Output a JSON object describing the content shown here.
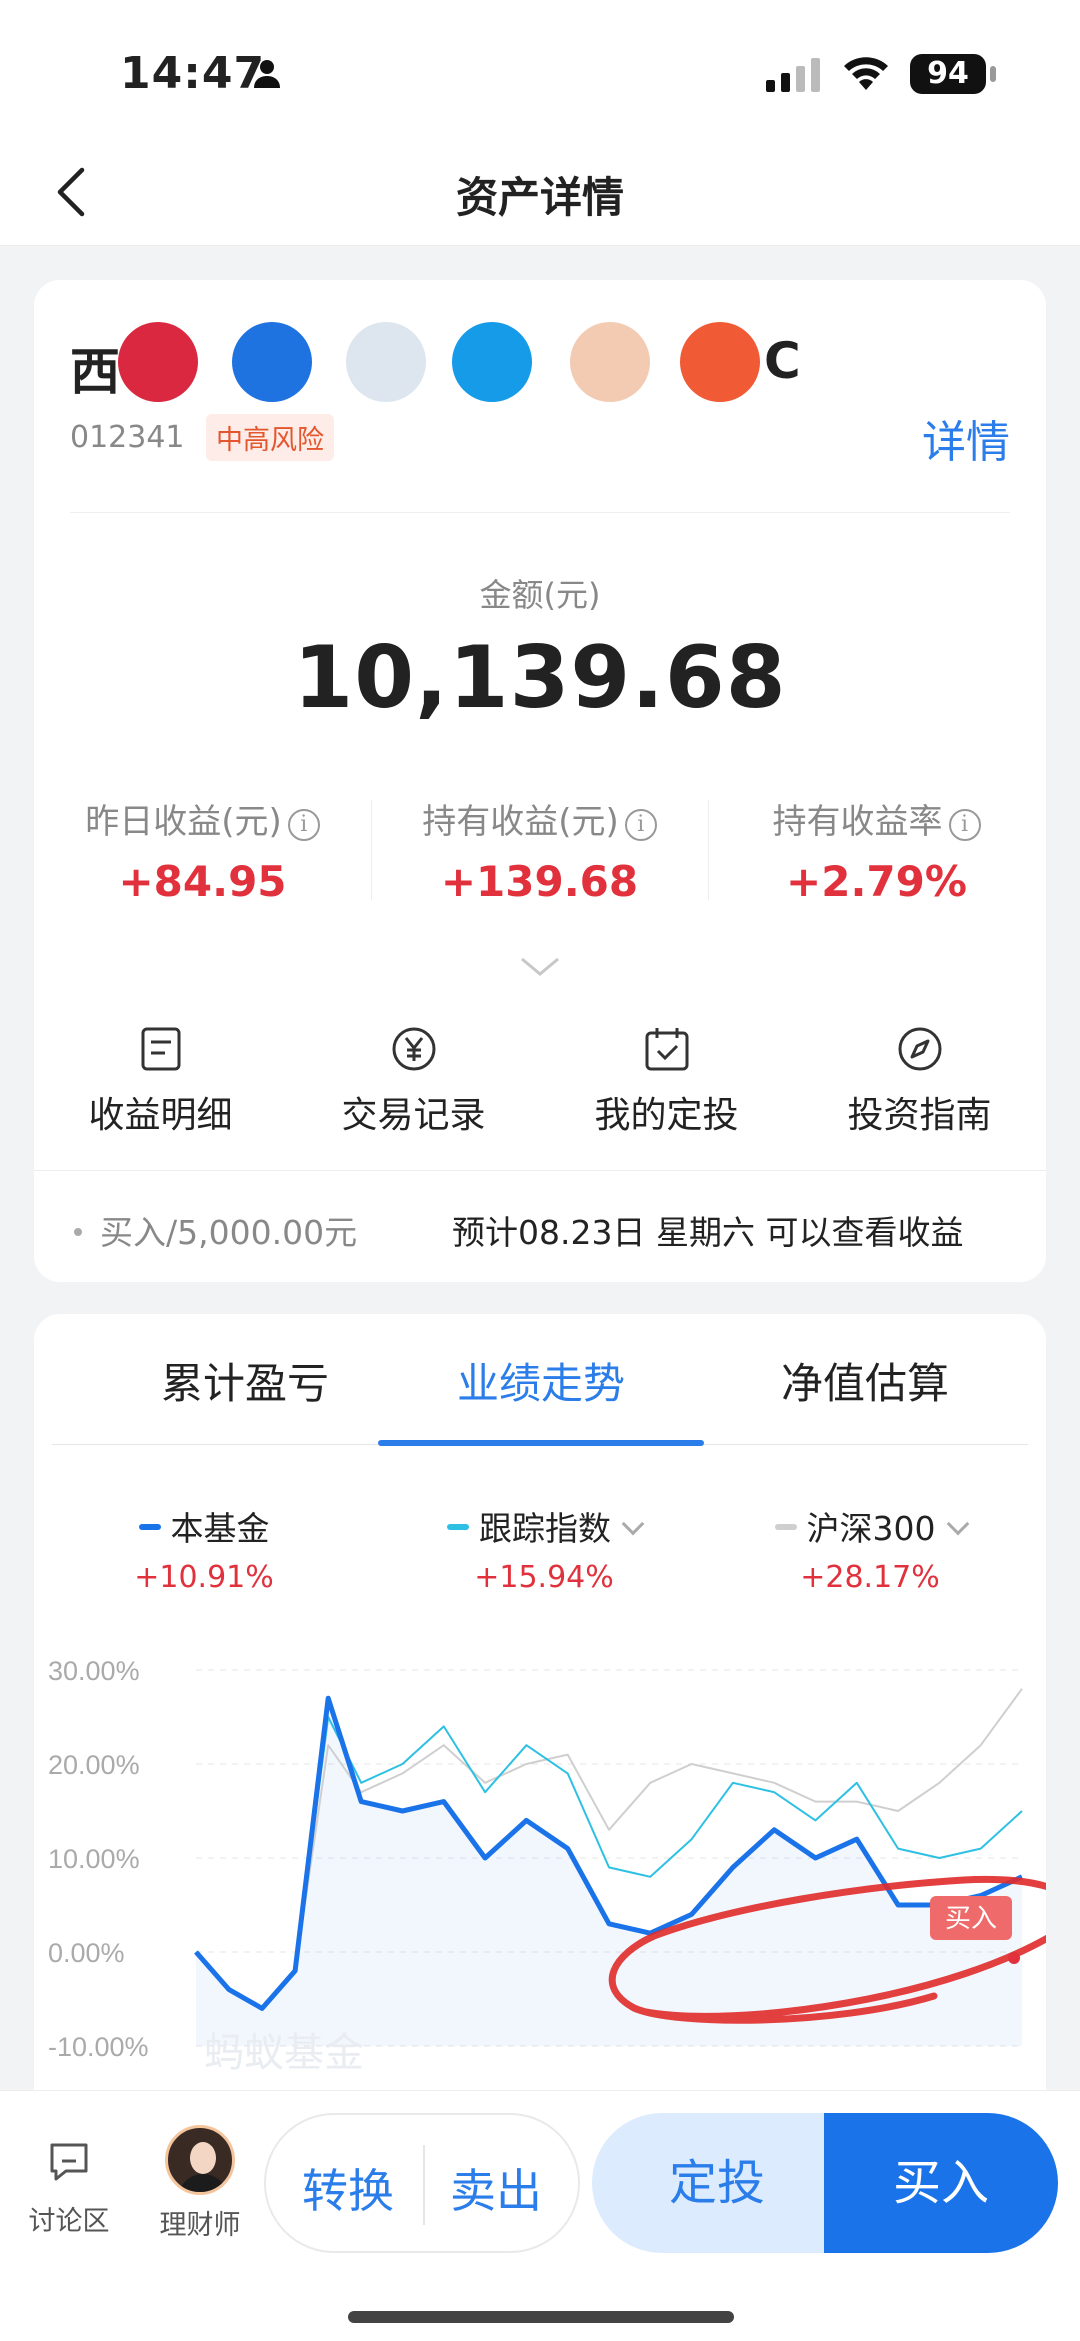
{
  "status_bar": {
    "time": "14:47",
    "battery": "94"
  },
  "nav": {
    "title": "资产详情"
  },
  "fund": {
    "name_visible_start": "西",
    "name_visible_end": "C",
    "code": "012341",
    "risk": "中高风险",
    "detail_link": "详情"
  },
  "amount": {
    "label": "金额(元)",
    "value": "10,139.68"
  },
  "stats": [
    {
      "label": "昨日收益(元)",
      "value": "+84.95"
    },
    {
      "label": "持有收益(元)",
      "value": "+139.68"
    },
    {
      "label": "持有收益率",
      "value": "+2.79%"
    }
  ],
  "actions": [
    {
      "label": "收益明细",
      "icon": "document-icon"
    },
    {
      "label": "交易记录",
      "icon": "yen-circle-icon"
    },
    {
      "label": "我的定投",
      "icon": "calendar-check-icon"
    },
    {
      "label": "投资指南",
      "icon": "compass-icon"
    }
  ],
  "buy_note": {
    "text": "买入/5,000.00元",
    "expect": "预计08.23日 星期六 可以查看收益"
  },
  "tabs": [
    "累计盈亏",
    "业绩走势",
    "净值估算"
  ],
  "active_tab": 1,
  "legend": [
    {
      "name": "本基金",
      "value": "+10.91%",
      "color": "#1a73e8"
    },
    {
      "name": "跟踪指数",
      "value": "+15.94%",
      "color": "#2ec0e3"
    },
    {
      "name": "沪深300",
      "value": "+28.17%",
      "color": "#cfcfcf"
    }
  ],
  "chart_watermark": "蚂蚁基金",
  "chart_buy_marker": "买入",
  "chart_data": {
    "type": "line",
    "y_ticks": [
      "30.00%",
      "20.00%",
      "10.00%",
      "0.00%",
      "-10.00%"
    ],
    "ylim": [
      -10,
      30
    ],
    "x": [
      0,
      4,
      8,
      12,
      16,
      20,
      25,
      30,
      35,
      40,
      45,
      50,
      55,
      60,
      65,
      70,
      75,
      80,
      85,
      90,
      95,
      100
    ],
    "series": [
      {
        "name": "本基金",
        "values": [
          0,
          -4,
          -6,
          -2,
          27,
          16,
          15,
          16,
          10,
          14,
          11,
          3,
          2,
          4,
          9,
          13,
          10,
          12,
          5,
          5,
          6,
          8
        ]
      },
      {
        "name": "跟踪指数",
        "values": [
          0,
          -4,
          -6,
          -2,
          25,
          18,
          20,
          24,
          17,
          22,
          19,
          9,
          8,
          12,
          18,
          17,
          14,
          18,
          11,
          10,
          11,
          15
        ]
      },
      {
        "name": "沪深300",
        "values": [
          0,
          -4,
          -6,
          -2,
          22,
          17,
          19,
          22,
          18,
          20,
          21,
          13,
          18,
          20,
          19,
          18,
          16,
          16,
          15,
          18,
          22,
          28
        ]
      }
    ]
  },
  "bottom_bar": {
    "discuss": "讨论区",
    "advisor": "理财师",
    "switch": "转换",
    "sell": "卖出",
    "auto_invest": "定投",
    "buy": "买入"
  }
}
